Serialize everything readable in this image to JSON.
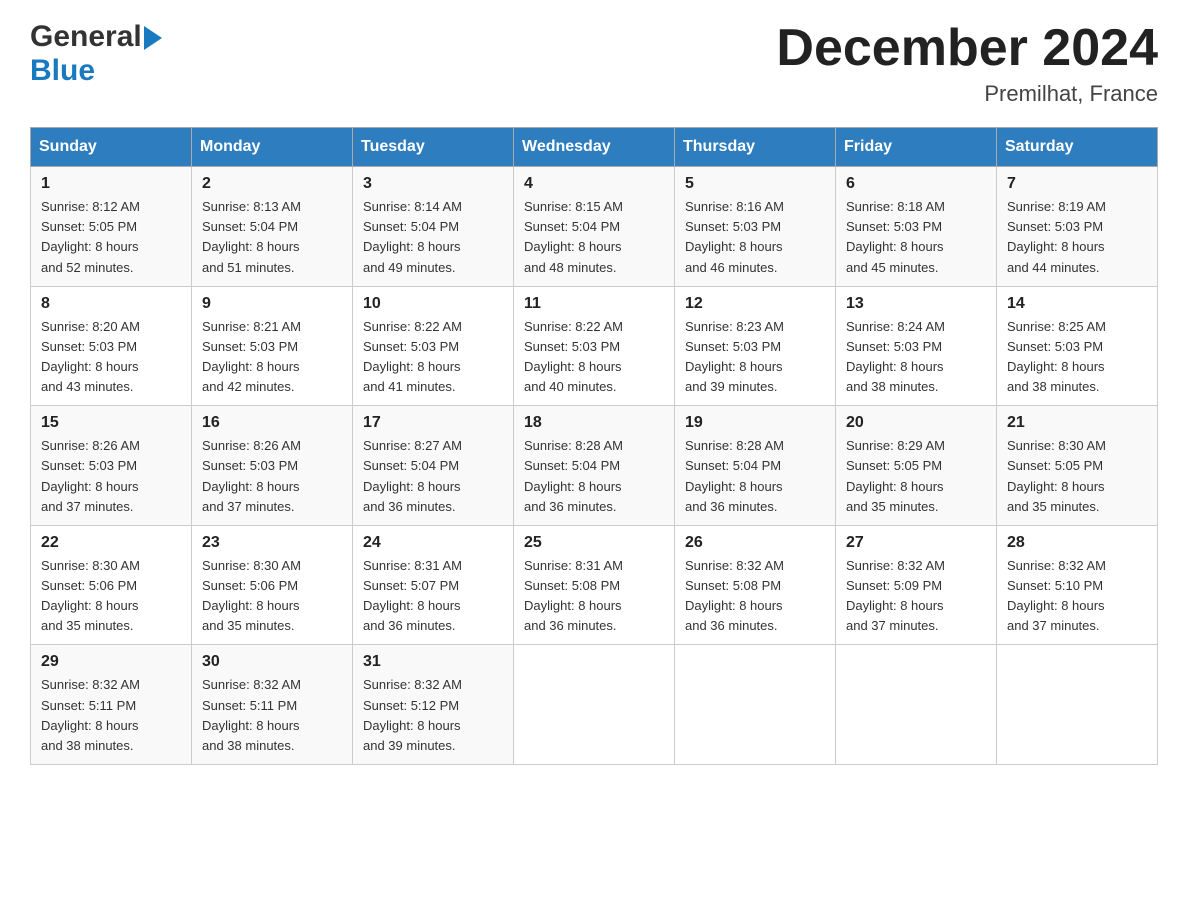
{
  "header": {
    "logo_general": "General",
    "logo_blue": "Blue",
    "title": "December 2024",
    "subtitle": "Premilhat, France"
  },
  "days_of_week": [
    "Sunday",
    "Monday",
    "Tuesday",
    "Wednesday",
    "Thursday",
    "Friday",
    "Saturday"
  ],
  "weeks": [
    [
      {
        "day": "1",
        "sunrise": "8:12 AM",
        "sunset": "5:05 PM",
        "daylight": "8 hours and 52 minutes."
      },
      {
        "day": "2",
        "sunrise": "8:13 AM",
        "sunset": "5:04 PM",
        "daylight": "8 hours and 51 minutes."
      },
      {
        "day": "3",
        "sunrise": "8:14 AM",
        "sunset": "5:04 PM",
        "daylight": "8 hours and 49 minutes."
      },
      {
        "day": "4",
        "sunrise": "8:15 AM",
        "sunset": "5:04 PM",
        "daylight": "8 hours and 48 minutes."
      },
      {
        "day": "5",
        "sunrise": "8:16 AM",
        "sunset": "5:03 PM",
        "daylight": "8 hours and 46 minutes."
      },
      {
        "day": "6",
        "sunrise": "8:18 AM",
        "sunset": "5:03 PM",
        "daylight": "8 hours and 45 minutes."
      },
      {
        "day": "7",
        "sunrise": "8:19 AM",
        "sunset": "5:03 PM",
        "daylight": "8 hours and 44 minutes."
      }
    ],
    [
      {
        "day": "8",
        "sunrise": "8:20 AM",
        "sunset": "5:03 PM",
        "daylight": "8 hours and 43 minutes."
      },
      {
        "day": "9",
        "sunrise": "8:21 AM",
        "sunset": "5:03 PM",
        "daylight": "8 hours and 42 minutes."
      },
      {
        "day": "10",
        "sunrise": "8:22 AM",
        "sunset": "5:03 PM",
        "daylight": "8 hours and 41 minutes."
      },
      {
        "day": "11",
        "sunrise": "8:22 AM",
        "sunset": "5:03 PM",
        "daylight": "8 hours and 40 minutes."
      },
      {
        "day": "12",
        "sunrise": "8:23 AM",
        "sunset": "5:03 PM",
        "daylight": "8 hours and 39 minutes."
      },
      {
        "day": "13",
        "sunrise": "8:24 AM",
        "sunset": "5:03 PM",
        "daylight": "8 hours and 38 minutes."
      },
      {
        "day": "14",
        "sunrise": "8:25 AM",
        "sunset": "5:03 PM",
        "daylight": "8 hours and 38 minutes."
      }
    ],
    [
      {
        "day": "15",
        "sunrise": "8:26 AM",
        "sunset": "5:03 PM",
        "daylight": "8 hours and 37 minutes."
      },
      {
        "day": "16",
        "sunrise": "8:26 AM",
        "sunset": "5:03 PM",
        "daylight": "8 hours and 37 minutes."
      },
      {
        "day": "17",
        "sunrise": "8:27 AM",
        "sunset": "5:04 PM",
        "daylight": "8 hours and 36 minutes."
      },
      {
        "day": "18",
        "sunrise": "8:28 AM",
        "sunset": "5:04 PM",
        "daylight": "8 hours and 36 minutes."
      },
      {
        "day": "19",
        "sunrise": "8:28 AM",
        "sunset": "5:04 PM",
        "daylight": "8 hours and 36 minutes."
      },
      {
        "day": "20",
        "sunrise": "8:29 AM",
        "sunset": "5:05 PM",
        "daylight": "8 hours and 35 minutes."
      },
      {
        "day": "21",
        "sunrise": "8:30 AM",
        "sunset": "5:05 PM",
        "daylight": "8 hours and 35 minutes."
      }
    ],
    [
      {
        "day": "22",
        "sunrise": "8:30 AM",
        "sunset": "5:06 PM",
        "daylight": "8 hours and 35 minutes."
      },
      {
        "day": "23",
        "sunrise": "8:30 AM",
        "sunset": "5:06 PM",
        "daylight": "8 hours and 35 minutes."
      },
      {
        "day": "24",
        "sunrise": "8:31 AM",
        "sunset": "5:07 PM",
        "daylight": "8 hours and 36 minutes."
      },
      {
        "day": "25",
        "sunrise": "8:31 AM",
        "sunset": "5:08 PM",
        "daylight": "8 hours and 36 minutes."
      },
      {
        "day": "26",
        "sunrise": "8:32 AM",
        "sunset": "5:08 PM",
        "daylight": "8 hours and 36 minutes."
      },
      {
        "day": "27",
        "sunrise": "8:32 AM",
        "sunset": "5:09 PM",
        "daylight": "8 hours and 37 minutes."
      },
      {
        "day": "28",
        "sunrise": "8:32 AM",
        "sunset": "5:10 PM",
        "daylight": "8 hours and 37 minutes."
      }
    ],
    [
      {
        "day": "29",
        "sunrise": "8:32 AM",
        "sunset": "5:11 PM",
        "daylight": "8 hours and 38 minutes."
      },
      {
        "day": "30",
        "sunrise": "8:32 AM",
        "sunset": "5:11 PM",
        "daylight": "8 hours and 38 minutes."
      },
      {
        "day": "31",
        "sunrise": "8:32 AM",
        "sunset": "5:12 PM",
        "daylight": "8 hours and 39 minutes."
      },
      null,
      null,
      null,
      null
    ]
  ],
  "labels": {
    "sunrise": "Sunrise:",
    "sunset": "Sunset:",
    "daylight": "Daylight:"
  }
}
